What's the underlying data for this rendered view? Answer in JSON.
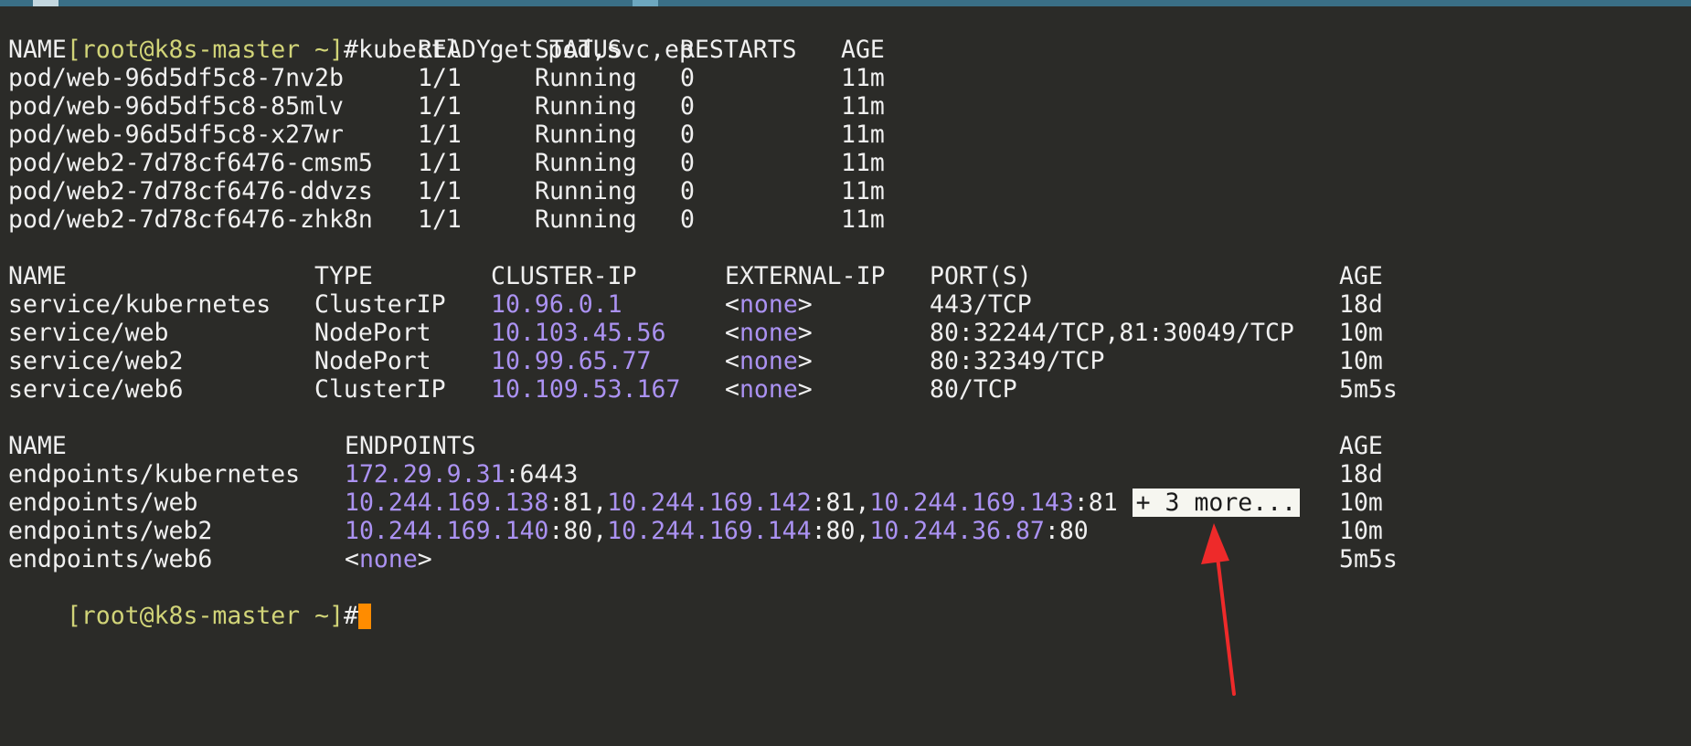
{
  "command_prompt": {
    "bracket_open": "[",
    "user": "root",
    "at": "@",
    "host": "k8s-master",
    "path": " ~",
    "bracket_close": "]",
    "symbol": "#",
    "command": "kubectl  get pod,svc,ep"
  },
  "pods": {
    "headers": [
      "NAME",
      "READY",
      "STATUS",
      "RESTARTS",
      "AGE"
    ],
    "rows": [
      {
        "name": "pod/web-96d5df5c8-7nv2b",
        "ready": "1/1",
        "status": "Running",
        "restarts": "0",
        "age": "11m"
      },
      {
        "name": "pod/web-96d5df5c8-85mlv",
        "ready": "1/1",
        "status": "Running",
        "restarts": "0",
        "age": "11m"
      },
      {
        "name": "pod/web-96d5df5c8-x27wr",
        "ready": "1/1",
        "status": "Running",
        "restarts": "0",
        "age": "11m"
      },
      {
        "name": "pod/web2-7d78cf6476-cmsm5",
        "ready": "1/1",
        "status": "Running",
        "restarts": "0",
        "age": "11m"
      },
      {
        "name": "pod/web2-7d78cf6476-ddvzs",
        "ready": "1/1",
        "status": "Running",
        "restarts": "0",
        "age": "11m"
      },
      {
        "name": "pod/web2-7d78cf6476-zhk8n",
        "ready": "1/1",
        "status": "Running",
        "restarts": "0",
        "age": "11m"
      }
    ]
  },
  "services": {
    "headers": [
      "NAME",
      "TYPE",
      "CLUSTER-IP",
      "EXTERNAL-IP",
      "PORT(S)",
      "AGE"
    ],
    "rows": [
      {
        "name": "service/kubernetes",
        "type": "ClusterIP",
        "cluster_ip": "10.96.0.1",
        "ext_lt": "<",
        "ext_none": "none",
        "ext_gt": ">",
        "ports": "443/TCP",
        "age": "18d"
      },
      {
        "name": "service/web",
        "type": "NodePort",
        "cluster_ip": "10.103.45.56",
        "ext_lt": "<",
        "ext_none": "none",
        "ext_gt": ">",
        "ports": "80:32244/TCP,81:30049/TCP",
        "age": "10m"
      },
      {
        "name": "service/web2",
        "type": "NodePort",
        "cluster_ip": "10.99.65.77",
        "ext_lt": "<",
        "ext_none": "none",
        "ext_gt": ">",
        "ports": "80:32349/TCP",
        "age": "10m"
      },
      {
        "name": "service/web6",
        "type": "ClusterIP",
        "cluster_ip": "10.109.53.167",
        "ext_lt": "<",
        "ext_none": "none",
        "ext_gt": ">",
        "ports": "80/TCP",
        "age": "5m5s"
      }
    ]
  },
  "endpoints": {
    "headers": [
      "NAME",
      "ENDPOINTS",
      "AGE"
    ],
    "rows": [
      {
        "name": "endpoints/kubernetes",
        "segments": [
          {
            "ip": "172.29.9.31",
            "port": ":6443"
          }
        ],
        "age": "18d"
      },
      {
        "name": "endpoints/web",
        "segments": [
          {
            "ip": "10.244.169.138",
            "port": ":81,"
          },
          {
            "ip": "10.244.169.142",
            "port": ":81,"
          },
          {
            "ip": "10.244.169.143",
            "port": ":81"
          }
        ],
        "more": "+ 3 more...",
        "age": "10m"
      },
      {
        "name": "endpoints/web2",
        "segments": [
          {
            "ip": "10.244.169.140",
            "port": ":80,"
          },
          {
            "ip": "10.244.169.144",
            "port": ":80,"
          },
          {
            "ip": "10.244.36.87",
            "port": ":80"
          }
        ],
        "age": "10m"
      },
      {
        "name": "endpoints/web6",
        "none_lt": "<",
        "none_word": "none",
        "none_gt": ">",
        "age": "5m5s"
      }
    ]
  },
  "colors": {
    "background": "#2b2b28",
    "foreground": "#f0f0f0",
    "ip_purple": "#ab92f2",
    "prompt_yellow": "#d1d478",
    "cursor_orange": "#ff8c00",
    "annotation_red": "#ee2a2a",
    "highlight_bg": "#f6f6f0"
  },
  "icons": {
    "annotation": "red-arrow-icon",
    "cursor": "block-cursor"
  }
}
